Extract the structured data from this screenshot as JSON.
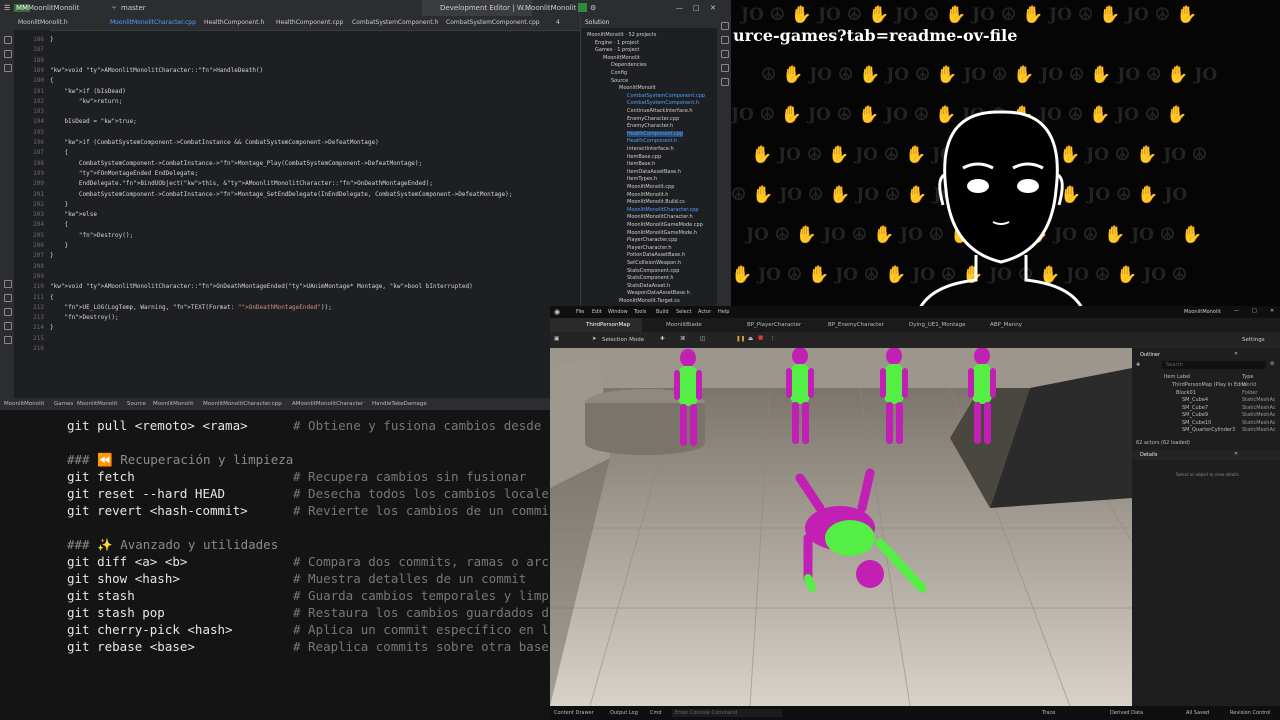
{
  "ide": {
    "project": "MoonlitMonolit",
    "branch": "master",
    "tabs": [
      "MoonlitMonolit.h",
      "MoonlitMonolitCharacter.cpp",
      "HealthComponent.h",
      "HealthComponent.cpp",
      "CombatSystemComponent.h",
      "CombatSystemComponent.cpp"
    ],
    "title_center": "Development Editor | W...",
    "title_right": "MoonlitMonolit",
    "line_numbers": [
      "186",
      "187",
      "188",
      "189",
      "190",
      "191",
      "192",
      "193",
      "194",
      "195",
      "196",
      "197",
      "198",
      "199",
      "200",
      "201",
      "202",
      "203",
      "204",
      "205",
      "206",
      "207",
      "208",
      "209",
      "210",
      "211",
      "212",
      "213",
      "214",
      "215",
      "216"
    ],
    "code": [
      "}",
      "",
      "",
      "void AMoonlitMonolitCharacter::HandleDeath()",
      "{",
      "    if (bIsDead)",
      "        return;",
      "",
      "    bIsDead = true;",
      "",
      "    if (CombatSystemComponent->CombatInstance && CombatSystemComponent->DefeatMontage)",
      "    {",
      "        CombatSystemComponent->CombatInstance->Montage_Play(CombatSystemComponent->DefeatMontage);",
      "        FOnMontageEnded EndDelegate;",
      "        EndDelegate.BindUObject(this, &AMoonlitMonolitCharacter::OnDeathMontageEnded);",
      "        CombatSystemComponent->CombatInstance->Montage_SetEndDelegate(InEndDelegate, CombatSystemComponent->DefeatMontage);",
      "    }",
      "    else",
      "    {",
      "        Destroy();",
      "    }",
      "}",
      "",
      "",
      "void AMoonlitMonolitCharacter::OnDeathMontageEnded(UAnimMontage* Montage, bool bInterrupted)",
      "{",
      "    UE_LOG(LogTemp, Warning, TEXT(Format: \"OnDeathMontageEnded\"));",
      "    Destroy();",
      "}",
      "",
      ""
    ],
    "solution_title": "Solution",
    "solution_tree": [
      {
        "t": "MoonlitMonolit · 52 projects",
        "lvl": 0
      },
      {
        "t": "Engine · 1 project",
        "lvl": 1
      },
      {
        "t": "Games · 1 project",
        "lvl": 1
      },
      {
        "t": "MoonlitMonolit",
        "lvl": 2
      },
      {
        "t": "Dependencies",
        "lvl": 3
      },
      {
        "t": "Config",
        "lvl": 3
      },
      {
        "t": "Source",
        "lvl": 3
      },
      {
        "t": "MoonlitMonolit",
        "lvl": 4
      },
      {
        "t": "CombatSystemComponent.cpp",
        "lvl": 5,
        "hl": true
      },
      {
        "t": "CombatSystemComponent.h",
        "lvl": 5,
        "hl": true
      },
      {
        "t": "ContinueAttackInterface.h",
        "lvl": 5
      },
      {
        "t": "EnemyCharacter.cpp",
        "lvl": 5
      },
      {
        "t": "EnemyCharacter.h",
        "lvl": 5
      },
      {
        "t": "HealthComponent.cpp",
        "lvl": 5,
        "hl": true,
        "sel": true
      },
      {
        "t": "HealthComponent.h",
        "lvl": 5,
        "hl": true
      },
      {
        "t": "InteractInterface.h",
        "lvl": 5
      },
      {
        "t": "ItemBase.cpp",
        "lvl": 5
      },
      {
        "t": "ItemBase.h",
        "lvl": 5
      },
      {
        "t": "ItemDataAssetBase.h",
        "lvl": 5
      },
      {
        "t": "ItemTypes.h",
        "lvl": 5
      },
      {
        "t": "MoonlitMonolit.cpp",
        "lvl": 5
      },
      {
        "t": "MoonlitMonolit.h",
        "lvl": 5
      },
      {
        "t": "MoonlitMonolit.Build.cs",
        "lvl": 5
      },
      {
        "t": "MoonlitMonolitCharacter.cpp",
        "lvl": 5,
        "hl": true
      },
      {
        "t": "MoonlitMonolitCharacter.h",
        "lvl": 5
      },
      {
        "t": "MoonlitMonolitGameMode.cpp",
        "lvl": 5
      },
      {
        "t": "MoonlitMonolitGameMode.h",
        "lvl": 5
      },
      {
        "t": "PlayerCharacter.cpp",
        "lvl": 5
      },
      {
        "t": "PlayerCharacter.h",
        "lvl": 5
      },
      {
        "t": "PotionDataAssetBase.h",
        "lvl": 5
      },
      {
        "t": "SetCollisionWeapon.h",
        "lvl": 5
      },
      {
        "t": "StatsComponent.cpp",
        "lvl": 5
      },
      {
        "t": "StatsComponent.h",
        "lvl": 5
      },
      {
        "t": "StatsDataAsset.h",
        "lvl": 5
      },
      {
        "t": "WeaponDataAssetBase.h",
        "lvl": 5
      },
      {
        "t": "MoonlitMonolit.Target.cs",
        "lvl": 4
      }
    ],
    "status_path": [
      "MoonlitMonolit",
      "Games",
      "MoonlitMonolit",
      "Source",
      "MoonlitMonolit",
      "MoonlitMonolitCharacter.cpp",
      "AMoonlitMonolitCharacter",
      "HandleTakeDamage"
    ],
    "warn_count": "4"
  },
  "terminal": [
    {
      "cmd": "git pull <remoto> <rama>",
      "comment": "# Obtiene y fusiona cambios desde"
    },
    {
      "cmd": "",
      "comment": ""
    },
    {
      "cmd": "### ⏪ Recuperación y limpieza",
      "comment": "",
      "section": true
    },
    {
      "cmd": "git fetch",
      "comment": "# Recupera cambios sin fusionar"
    },
    {
      "cmd": "git reset --hard HEAD",
      "comment": "# Desecha todos los cambios locale"
    },
    {
      "cmd": "git revert <hash-commit>",
      "comment": "# Revierte los cambios de un commi"
    },
    {
      "cmd": "",
      "comment": ""
    },
    {
      "cmd": "### ✨ Avanzado y utilidades",
      "comment": "",
      "section": true
    },
    {
      "cmd": "git diff <a> <b>",
      "comment": "# Compara dos commits, ramas o arc"
    },
    {
      "cmd": "git show <hash>",
      "comment": "# Muestra detalles de un commit"
    },
    {
      "cmd": "git stash",
      "comment": "# Guarda cambios temporales y limp"
    },
    {
      "cmd": "git stash pop",
      "comment": "# Restaura los cambios guardados d"
    },
    {
      "cmd": "git cherry-pick <hash>",
      "comment": "# Aplica un commit específico en l"
    },
    {
      "cmd": "git rebase <base>",
      "comment": "# Reaplica commits sobre otra base"
    }
  ],
  "overlay": {
    "url_text": "urce-games?tab=readme-ov-file"
  },
  "unreal": {
    "menu": [
      "File",
      "Edit",
      "Window",
      "Tools",
      "Build",
      "Select",
      "Actor",
      "Help"
    ],
    "title": "MoonlitMonolit",
    "tabs": [
      "ThirdPersonMap",
      "MoonlitBlade",
      "BP_PlayerCharacter",
      "BP_EnemyCharacter",
      "Dying_UE1_Montage",
      "ABP_Manny"
    ],
    "selection_mode": "Selection Mode",
    "settings": "Settings",
    "outliner_title": "Outliner",
    "search_placeholder": "Search",
    "col_item": "Item Label",
    "col_type": "Type",
    "outliner_rows": [
      {
        "label": "ThirdPersonMap (Play In Edito",
        "type": "World"
      },
      {
        "label": "Block01",
        "type": "Folder"
      },
      {
        "label": "SM_Cube4",
        "type": "StaticMeshAc"
      },
      {
        "label": "SM_Cube7",
        "type": "StaticMeshAc"
      },
      {
        "label": "SM_Cube9",
        "type": "StaticMeshAc"
      },
      {
        "label": "SM_Cube10",
        "type": "StaticMeshAc"
      },
      {
        "label": "SM_QuarterCylinder3",
        "type": "StaticMeshAc"
      }
    ],
    "actor_count": "62 actors (62 loaded)",
    "details_title": "Details",
    "details_hint": "Select an object to view details.",
    "bottom": {
      "content_drawer": "Content Drawer",
      "output_log": "Output Log",
      "cmd": "Cmd",
      "console_placeholder": "Enter Console Command",
      "trace": "Trace",
      "derived": "Derived Data",
      "saved": "All Saved",
      "revision": "Revision Control"
    }
  },
  "colors": {
    "accent": "#4ea1ff",
    "body_green": "#55ee44",
    "body_magenta": "#c21fb4"
  }
}
